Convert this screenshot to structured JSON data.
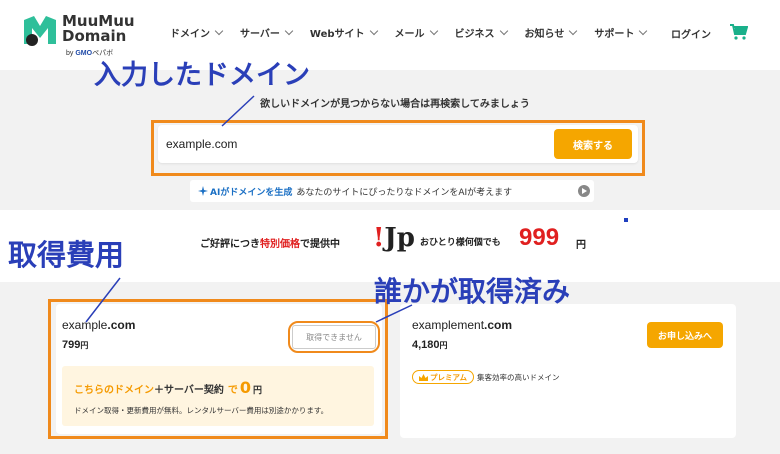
{
  "header": {
    "logo_line1": "MuuMuu",
    "logo_line2": "Domain",
    "logo_sub_by": "by",
    "logo_sub_brand": "GMO",
    "logo_sub_rest": "ペパボ",
    "nav": [
      {
        "label": "ドメイン"
      },
      {
        "label": "サーバー"
      },
      {
        "label": "Webサイト"
      },
      {
        "label": "メール"
      },
      {
        "label": "ビジネス"
      },
      {
        "label": "お知らせ"
      },
      {
        "label": "サポート"
      }
    ],
    "login_label": "ログイン",
    "cart_icon": "cart-icon"
  },
  "search": {
    "subtitle": "欲しいドメインが見つからない場合は再検索してみましょう",
    "input_value": "example.com",
    "button_label": "検索する"
  },
  "ai_bar": {
    "label": "AIがドメインを生成",
    "text": "あなたのサイトにぴったりなドメインをAIが考えます"
  },
  "promo": {
    "left_text_1": "ご好評につき",
    "left_text_red": "特別価格",
    "left_text_2": "で提供中",
    "jp_bang": "!",
    "jp_text": "Jp",
    "right_text": "おひとり様何個でも",
    "price": "999",
    "price_unit": "円"
  },
  "results": [
    {
      "name_prefix": "example",
      "name_tld": ".com",
      "price": "799",
      "price_unit": "円",
      "status_label": "取得できません",
      "offer": {
        "title_orange": "こちらのドメイン",
        "title_plus": "＋",
        "title_dark": "サーバー契約",
        "title_de": "で",
        "title_zero": "0",
        "title_yen": "円",
        "note": "ドメイン取得・更新費用が無料。レンタルサーバー費用は別途かかります。"
      }
    },
    {
      "name_prefix": "examplement",
      "name_tld": ".com",
      "price": "4,180",
      "price_unit": "円",
      "apply_label": "お申し込みへ",
      "badge": "プレミアム",
      "badge_note": "集客効率の高いドメイン"
    }
  ],
  "annotations": {
    "search": "入力したドメイン",
    "cost": "取得費用",
    "taken": "誰かが取得済み"
  },
  "colors": {
    "accent_orange": "#f5a600",
    "annotation_blue": "#2a3fb8",
    "frame_orange": "#f08a1c",
    "promo_red": "#e02020"
  }
}
